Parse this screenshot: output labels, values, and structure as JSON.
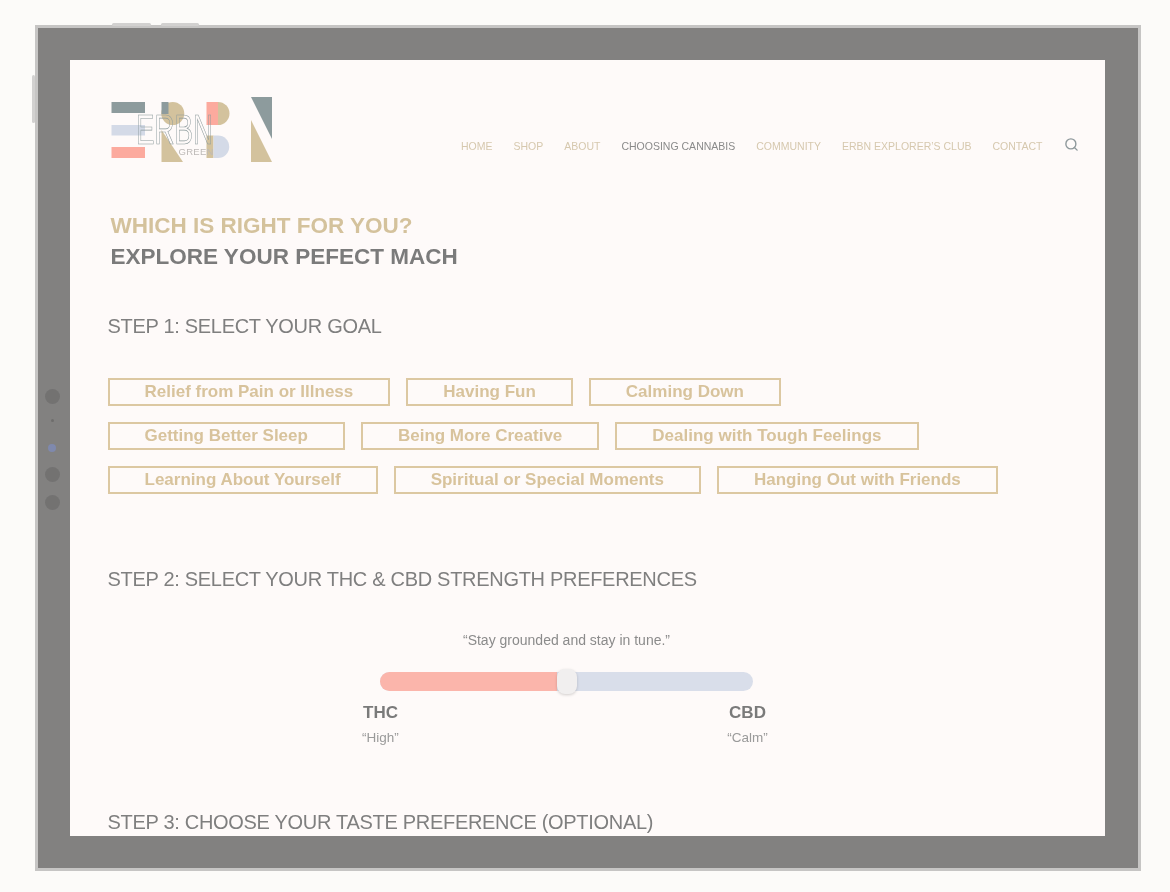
{
  "header": {
    "logo": {
      "wordmark": "ERBN",
      "tagline": "GREEN"
    },
    "nav": [
      {
        "label": "HOME",
        "selected": false
      },
      {
        "label": "SHOP",
        "selected": false
      },
      {
        "label": "ABOUT",
        "selected": false
      },
      {
        "label": "CHOOSING CANNABIS",
        "selected": true
      },
      {
        "label": "COMMUNITY",
        "selected": false
      },
      {
        "label": "ERBN EXPLORER’S CLUB",
        "selected": false
      },
      {
        "label": "CONTACT",
        "selected": false
      }
    ]
  },
  "intro": {
    "title": "WHICH IS RIGHT FOR YOU?",
    "subtitle": "EXPLORE YOUR PEFECT MACH"
  },
  "steps": [
    {
      "kind": "goals",
      "title": "STEP 1: SELECT YOUR GOAL",
      "options": [
        {
          "label": "Relief from Pain or Illness",
          "selected": false
        },
        {
          "label": "Having Fun",
          "selected": false
        },
        {
          "label": "Calming Down",
          "selected": false
        },
        {
          "label": "Getting Better Sleep",
          "selected": false
        },
        {
          "label": "Being More Creative",
          "selected": false
        },
        {
          "label": "Dealing with Tough Feelings",
          "selected": false
        },
        {
          "label": "Learning About Yourself",
          "selected": false
        },
        {
          "label": "Spiritual or Special Moments",
          "selected": false
        },
        {
          "label": "Hanging Out with Friends",
          "selected": false
        }
      ]
    },
    {
      "kind": "slider",
      "title": "STEP 2: SELECT YOUR THC & CBD STRENGTH PREFERENCES",
      "quote": "“Stay grounded and stay in tune.”",
      "level": 0.5,
      "ends": [
        {
          "name": "THC",
          "note": "“High”"
        },
        {
          "name": "CBD",
          "note": "“Calm”"
        }
      ]
    },
    {
      "kind": "heading",
      "title": "STEP 3: CHOOSE YOUR TASTE PREFERENCE (OPTIONAL)"
    }
  ]
}
